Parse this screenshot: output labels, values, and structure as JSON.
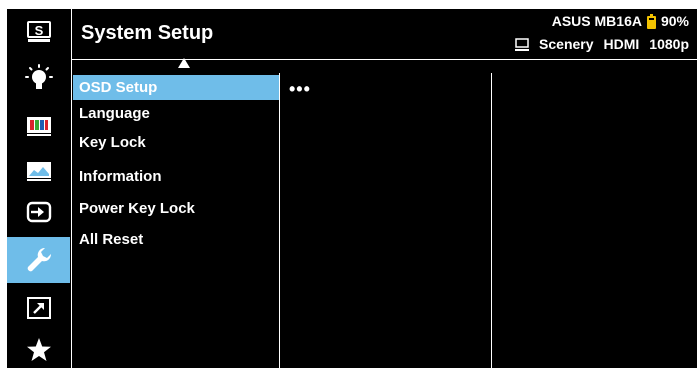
{
  "header": {
    "title": "System Setup",
    "model": "ASUS MB16A",
    "battery_percent": "90%",
    "mode": "Scenery",
    "input": "HDMI",
    "resolution": "1080p"
  },
  "sidebar": {
    "items": [
      {
        "name": "splendid-icon",
        "glyph": "S"
      },
      {
        "name": "blue-light-filter-icon"
      },
      {
        "name": "color-icon"
      },
      {
        "name": "image-icon"
      },
      {
        "name": "input-select-icon"
      },
      {
        "name": "system-setup-icon",
        "active": true
      },
      {
        "name": "shortcut-icon"
      },
      {
        "name": "myfavorite-icon"
      }
    ]
  },
  "menu": {
    "items": [
      {
        "label": "OSD Setup",
        "active": true
      },
      {
        "label": "Language"
      },
      {
        "label": "Key Lock"
      },
      {
        "label": "Information"
      },
      {
        "label": "Power Key Lock"
      },
      {
        "label": "All Reset"
      }
    ]
  },
  "submenu": {
    "indicator": "•••"
  },
  "colors": {
    "background": "#000000",
    "highlight": "#6fbde9",
    "text": "#ffffff",
    "battery": "#f2c200"
  }
}
